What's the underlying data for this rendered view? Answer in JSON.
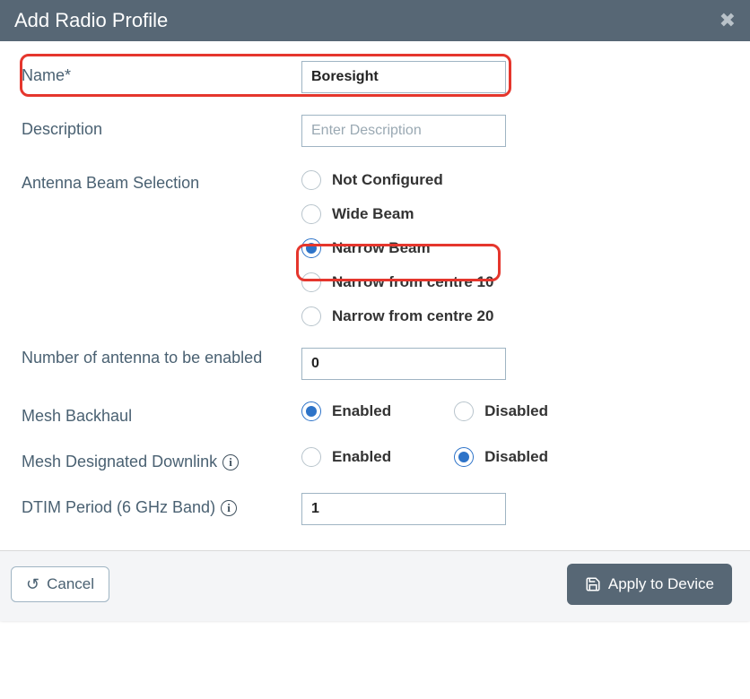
{
  "header": {
    "title": "Add Radio Profile"
  },
  "fields": {
    "name": {
      "label": "Name*",
      "value": "Boresight"
    },
    "description": {
      "label": "Description",
      "placeholder": "Enter Description",
      "value": ""
    },
    "antenna_beam": {
      "label": "Antenna Beam Selection",
      "options": {
        "not_configured": "Not Configured",
        "wide": "Wide Beam",
        "narrow": "Narrow Beam",
        "narrow10": "Narrow from centre 10",
        "narrow20": "Narrow from centre 20"
      },
      "selected": "narrow"
    },
    "antenna_count": {
      "label": "Number of antenna to be enabled",
      "value": "0"
    },
    "mesh_backhaul": {
      "label": "Mesh Backhaul",
      "options": {
        "enabled": "Enabled",
        "disabled": "Disabled"
      },
      "selected": "enabled"
    },
    "mesh_downlink": {
      "label": "Mesh Designated Downlink",
      "options": {
        "enabled": "Enabled",
        "disabled": "Disabled"
      },
      "selected": "disabled"
    },
    "dtim": {
      "label": "DTIM Period (6 GHz Band)",
      "value": "1"
    }
  },
  "footer": {
    "cancel": "Cancel",
    "apply": "Apply to Device"
  }
}
